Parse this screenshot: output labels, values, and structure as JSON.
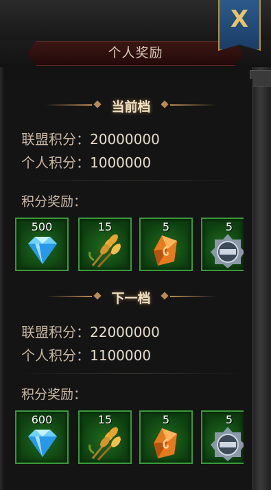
{
  "window": {
    "title": "个人奖励",
    "close_label": "X"
  },
  "current_tier": {
    "header": "当前档",
    "alliance_label": "联盟积分：",
    "alliance_value": "20000000",
    "personal_label": "个人积分：",
    "personal_value": "1000000",
    "rewards_label": "积分奖励：",
    "rewards": [
      {
        "icon": "diamond-icon",
        "qty": "500"
      },
      {
        "icon": "wheat-icon",
        "qty": "15"
      },
      {
        "icon": "amber-crystal-icon",
        "qty": "5"
      },
      {
        "icon": "silver-medal-icon",
        "qty": "5"
      }
    ]
  },
  "next_tier": {
    "header": "下一档",
    "alliance_label": "联盟积分：",
    "alliance_value": "22000000",
    "personal_label": "个人积分：",
    "personal_value": "1100000",
    "rewards_label": "积分奖励：",
    "rewards": [
      {
        "icon": "diamond-icon",
        "qty": "600"
      },
      {
        "icon": "wheat-icon",
        "qty": "15"
      },
      {
        "icon": "amber-crystal-icon",
        "qty": "5"
      },
      {
        "icon": "silver-medal-icon",
        "qty": "5"
      }
    ]
  },
  "colors": {
    "accent_gold": "#e7c46b",
    "slot_border": "#3a9a3a",
    "title_plate": "#3b1614",
    "close_button": "#2c5a8a"
  }
}
